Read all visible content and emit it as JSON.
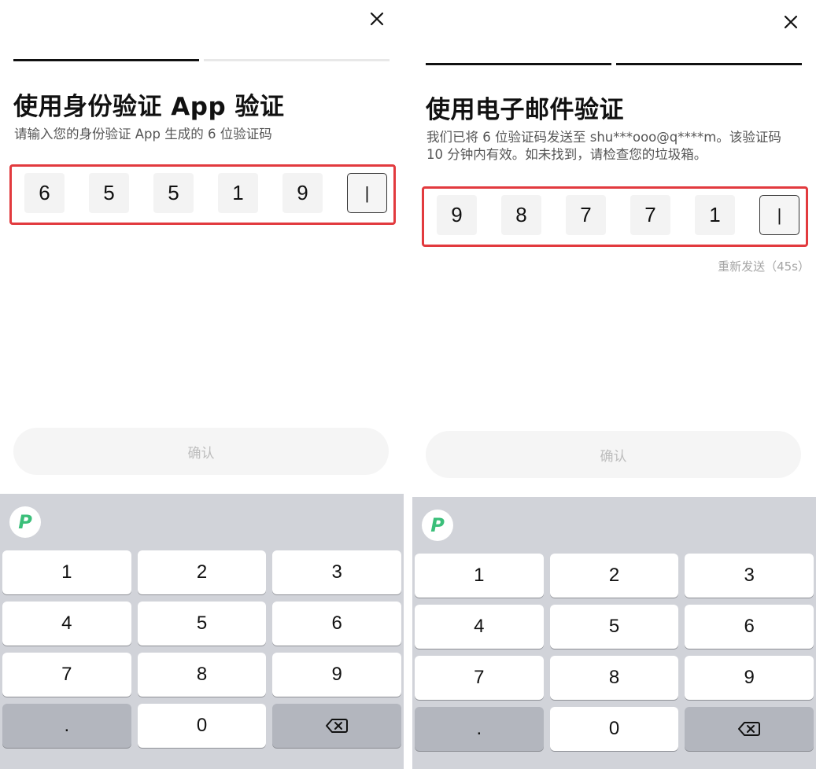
{
  "left": {
    "title": "使用身份验证 App 验证",
    "subtitle": "请输入您的身份验证 App 生成的 6 位验证码",
    "digits": [
      "6",
      "5",
      "5",
      "1",
      "9",
      "|"
    ],
    "confirm_label": "确认",
    "progress_steps": 2,
    "progress_done": 1
  },
  "right": {
    "title": "使用电子邮件验证",
    "subtitle": "我们已将 6 位验证码发送至 shu***ooo@q****m。该验证码 10 分钟内有效。如未找到，请检查您的垃圾箱。",
    "digits": [
      "9",
      "8",
      "7",
      "7",
      "1",
      "|"
    ],
    "resend_label": "重新发送（45s）",
    "confirm_label": "确认",
    "progress_steps": 2,
    "progress_done": 2
  },
  "keyboard": {
    "logo": "P",
    "keys": [
      "1",
      "2",
      "3",
      "4",
      "5",
      "6",
      "7",
      "8",
      "9",
      ".",
      "0",
      ""
    ],
    "delete_icon": "backspace-icon"
  },
  "icons": {
    "close": "close-icon"
  },
  "colors": {
    "highlight_border": "#e23a3e",
    "keyboard_bg": "#d1d3d9",
    "logo_green": "#3bbf7a",
    "confirm_disabled_bg": "#f5f5f5",
    "confirm_disabled_text": "#bdbdbd"
  }
}
